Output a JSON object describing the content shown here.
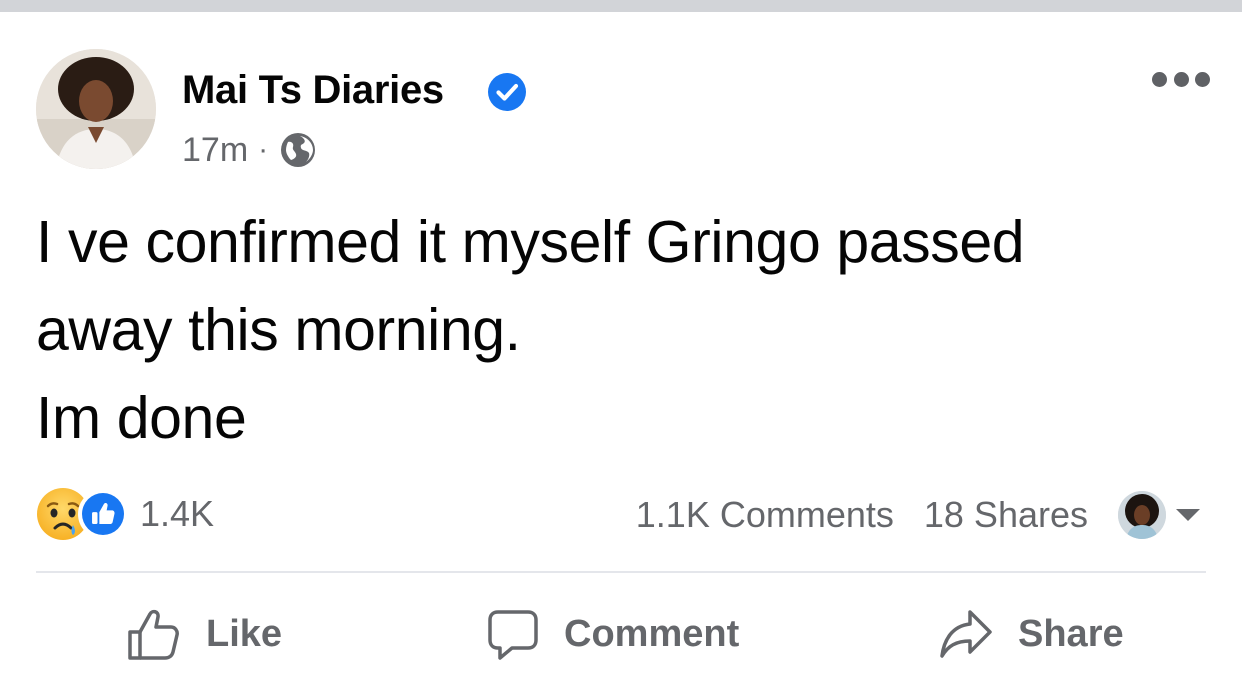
{
  "post": {
    "author": "Mai Ts Diaries",
    "verified": true,
    "time": "17m",
    "separator": "·",
    "audience_icon": "globe-icon",
    "text_lines": [
      "I ve confirmed it myself Gringo passed",
      "away this morning.",
      "Im done"
    ]
  },
  "reactions": {
    "icons": [
      "sad-reaction-icon",
      "like-reaction-icon"
    ],
    "count": "1.4K"
  },
  "stats": {
    "comments": "1.1K Comments",
    "shares": "18 Shares"
  },
  "actions": {
    "like": "Like",
    "comment": "Comment",
    "share": "Share"
  },
  "colors": {
    "brand_blue": "#1877f2",
    "secondary_text": "#65676b",
    "primary_text": "#050505",
    "divider": "#e4e6eb"
  }
}
